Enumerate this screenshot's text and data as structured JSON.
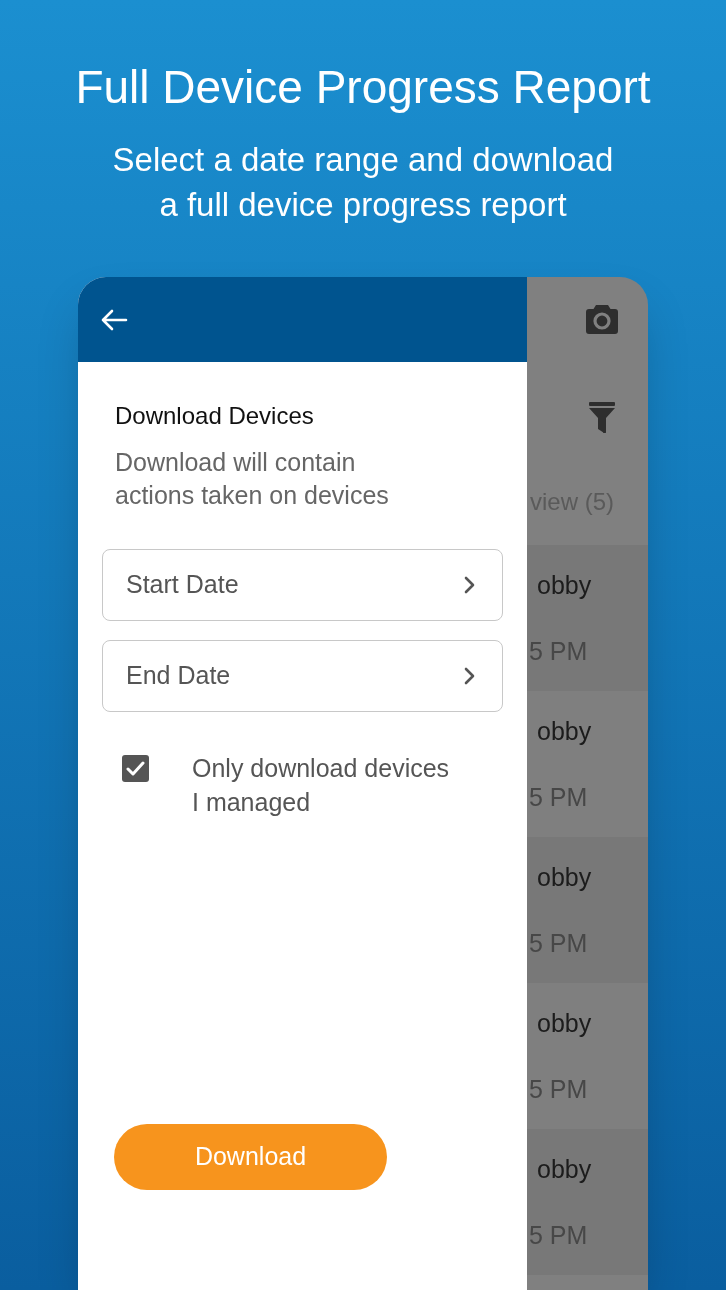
{
  "banner": {
    "title": "Full Device Progress Report",
    "subtitle": "Select a date range and download\na full device progress report"
  },
  "drawer": {
    "heading": "Download Devices",
    "description": "Download will contain\nactions taken on devices",
    "fields": [
      {
        "placeholder": "Start Date"
      },
      {
        "placeholder": "End Date"
      }
    ],
    "option": {
      "label": "Only download devices\nI managed",
      "checked": true
    },
    "button": "Download"
  },
  "background_screen": {
    "summary": "view (5)",
    "rows": [
      {
        "column_1": "obby",
        "column_2": "5 PM"
      },
      {
        "column_1": "obby",
        "column_2": "5 PM"
      },
      {
        "column_1": "obby",
        "column_2": "5 PM"
      },
      {
        "column_1": "obby",
        "column_2": "5 PM"
      },
      {
        "column_1": "obby",
        "column_2": "5 PM"
      }
    ]
  }
}
